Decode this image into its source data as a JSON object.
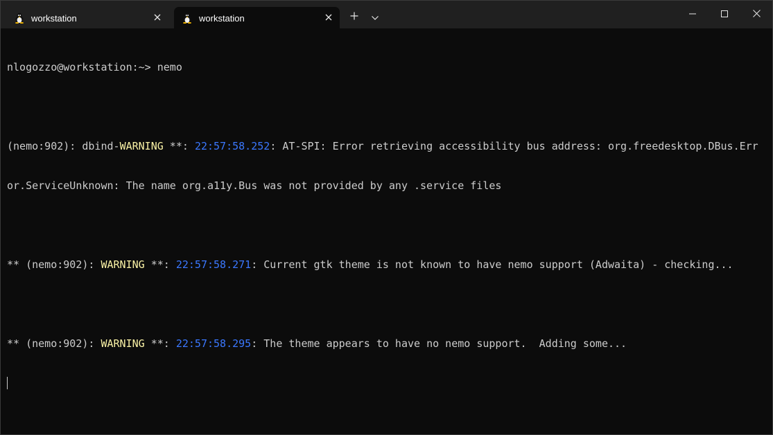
{
  "tabs": [
    {
      "title": "workstation",
      "icon": "linux-tux-icon",
      "active": false
    },
    {
      "title": "workstation",
      "icon": "linux-tux-icon",
      "active": true
    }
  ],
  "toolbar": {
    "new_tab_icon": "plus-icon",
    "dropdown_icon": "chevron-down-icon"
  },
  "window_controls": [
    "minimize-icon",
    "maximize-icon",
    "close-icon"
  ],
  "terminal": {
    "prompt": "nlogozzo@workstation:~> ",
    "command": "nemo",
    "log1": {
      "prefix": "(nemo:902): dbind-",
      "level": "WARNING",
      "sep": " **: ",
      "time": "22:57:58.252",
      "msg_line1": ": AT-SPI: Error retrieving accessibility bus address: org.freedesktop.DBus.Err",
      "msg_line2": "or.ServiceUnknown: The name org.a11y.Bus was not provided by any .service files"
    },
    "log2": {
      "prefix": "** (nemo:902): ",
      "level": "WARNING",
      "sep": " **: ",
      "time": "22:57:58.271",
      "msg": ": Current gtk theme is not known to have nemo support (Adwaita) - checking..."
    },
    "log3": {
      "prefix": "** (nemo:902): ",
      "level": "WARNING",
      "sep": " **: ",
      "time": "22:57:58.295",
      "msg": ": The theme appears to have no nemo support.  Adding some..."
    }
  },
  "colors": {
    "background": "#0c0c0c",
    "foreground": "#cccccc",
    "titlebar": "#202020",
    "warning": "#f9f1a5",
    "timestamp": "#3b78ff"
  }
}
